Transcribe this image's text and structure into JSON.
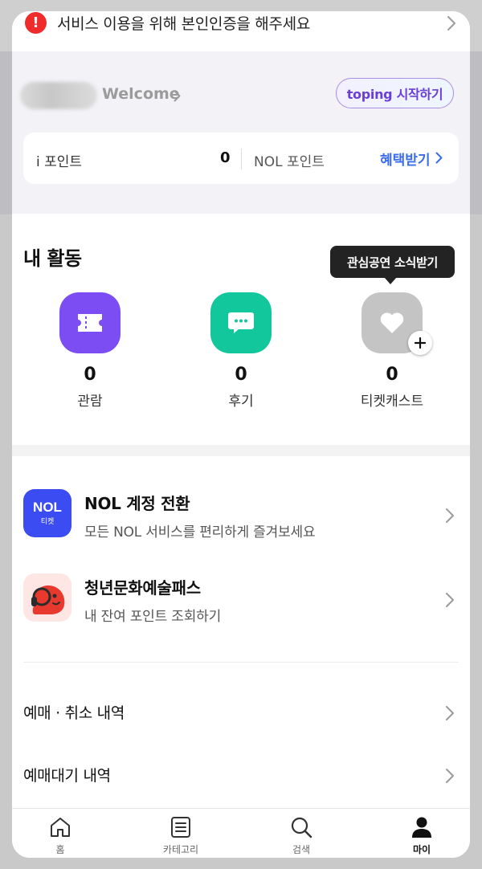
{
  "alert": {
    "text": "서비스 이용을 위해 본인인증을 해주세요",
    "icon": "exclamation-icon"
  },
  "profile": {
    "welcome": "Welcome",
    "toping_button": "toping 시작하기",
    "points": {
      "ipoint_label": "i 포인트",
      "ipoint_value": "0",
      "nol_label": "NOL 포인트",
      "benefit_label": "혜택받기"
    }
  },
  "activity": {
    "title": "내 활동",
    "tooltip": "관심공연 소식받기",
    "items": [
      {
        "label": "관람",
        "count": "0",
        "icon": "ticket-icon",
        "color": "#7b4df2"
      },
      {
        "label": "후기",
        "count": "0",
        "icon": "chat-bubble-icon",
        "color": "#12c79c"
      },
      {
        "label": "티켓캐스트",
        "count": "0",
        "icon": "heart-icon",
        "color": "#c4c4c4"
      }
    ]
  },
  "menu": {
    "nol_switch": {
      "title": "NOL 계정 전환",
      "subtitle": "모든 NOL 서비스를 편리하게 즐겨보세요",
      "logo_text": "NOL",
      "logo_sub": "티켓",
      "logo_color": "#3a4cf2"
    },
    "youth_pass": {
      "title": "청년문화예술패스",
      "subtitle": "내 잔여 포인트 조회하기"
    },
    "booking_history": "예매 · 취소 내역",
    "waitlist_history": "예매대기 내역"
  },
  "bottom_nav": [
    {
      "label": "홈",
      "icon": "home-icon",
      "active": false
    },
    {
      "label": "카테고리",
      "icon": "category-list-icon",
      "active": false
    },
    {
      "label": "검색",
      "icon": "search-icon",
      "active": false
    },
    {
      "label": "마이",
      "icon": "person-icon",
      "active": true
    }
  ],
  "colors": {
    "accent_blue": "#3b6cf0",
    "alert_red": "#ef2b2b",
    "toping_purple": "#6a3fd6"
  }
}
